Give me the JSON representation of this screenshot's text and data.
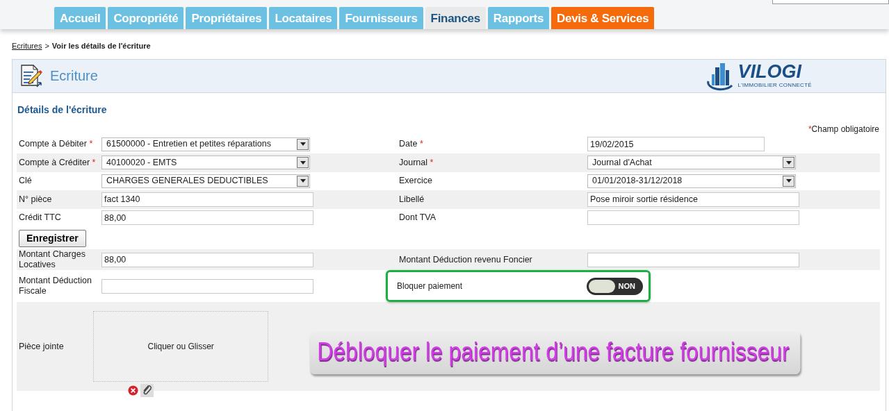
{
  "header": {
    "tabs": [
      {
        "label": "Accueil",
        "selected": false,
        "kind": "normal"
      },
      {
        "label": "Copropriété",
        "selected": false,
        "kind": "normal"
      },
      {
        "label": "Propriétaires",
        "selected": false,
        "kind": "normal"
      },
      {
        "label": "Locataires",
        "selected": false,
        "kind": "normal"
      },
      {
        "label": "Fournisseurs",
        "selected": false,
        "kind": "normal"
      },
      {
        "label": "Finances",
        "selected": true,
        "kind": "normal"
      },
      {
        "label": "Rapports",
        "selected": false,
        "kind": "normal"
      },
      {
        "label": "Devis & Services",
        "selected": false,
        "kind": "accent"
      }
    ]
  },
  "breadcrumb": {
    "link": "Ecritures",
    "separator": ">",
    "current": "Voir les détails de l'écriture"
  },
  "panel": {
    "title": "Ecriture",
    "logo": {
      "name": "VILOGI",
      "tagline": "L'IMMOBILIER CONNECTÉ"
    }
  },
  "section_title": "Détails de l'écriture",
  "required_note": {
    "mark": "*",
    "text": "Champ obligatoire"
  },
  "rows": [
    {
      "kind": "fields",
      "cells": [
        {
          "label": "Compte à Débiter",
          "required_mark": "*",
          "kind": "select",
          "value": "61500000 - Entretien et petites réparations"
        },
        {
          "label": "Date",
          "required_mark": "*",
          "kind": "short",
          "value": "19/02/2015"
        }
      ]
    },
    {
      "kind": "fields",
      "cells": [
        {
          "label": "Compte à Créditer",
          "required_mark": "*",
          "kind": "select",
          "value": "40100020 - EMTS"
        },
        {
          "label": "Journal",
          "required_mark": "*",
          "kind": "select",
          "value": "Journal d'Achat"
        }
      ]
    },
    {
      "kind": "fields",
      "cells": [
        {
          "label": "Clé",
          "kind": "select",
          "value": "CHARGES GENERALES DEDUCTIBLES"
        },
        {
          "label": "Exercice",
          "kind": "select",
          "value": "01/01/2018-31/12/2018"
        }
      ]
    },
    {
      "kind": "fields",
      "cells": [
        {
          "label": "N° pièce",
          "kind": "text",
          "value": "fact 1340"
        },
        {
          "label": "Libellé",
          "kind": "text",
          "value": "Pose miroir sortie résidence"
        }
      ]
    },
    {
      "kind": "fields",
      "cells": [
        {
          "label": "Crédit TTC",
          "kind": "text",
          "value": "88,00"
        },
        {
          "label": "Dont TVA",
          "kind": "text"
        }
      ]
    },
    {
      "kind": "button",
      "label": "Enregistrer"
    },
    {
      "kind": "fields",
      "cells": [
        {
          "label": "Montant Charges Locatives",
          "kind": "text",
          "value": "88,00"
        },
        {
          "label": "Montant Déduction revenu Foncier",
          "kind": "text"
        }
      ]
    },
    {
      "kind": "fields",
      "cells": [
        {
          "label": "Montant Déduction Fiscale",
          "kind": "text"
        },
        {
          "label": "Bloquer paiement",
          "kind": "toggle",
          "on": false,
          "text": "NON",
          "highlighted": true
        }
      ]
    },
    {
      "kind": "attachment",
      "label": "Pièce jointe",
      "dropzone": "Cliquer ou Glisser"
    }
  ],
  "overlay_caption": "Débloquer le paiement d’une facture fournisseur"
}
